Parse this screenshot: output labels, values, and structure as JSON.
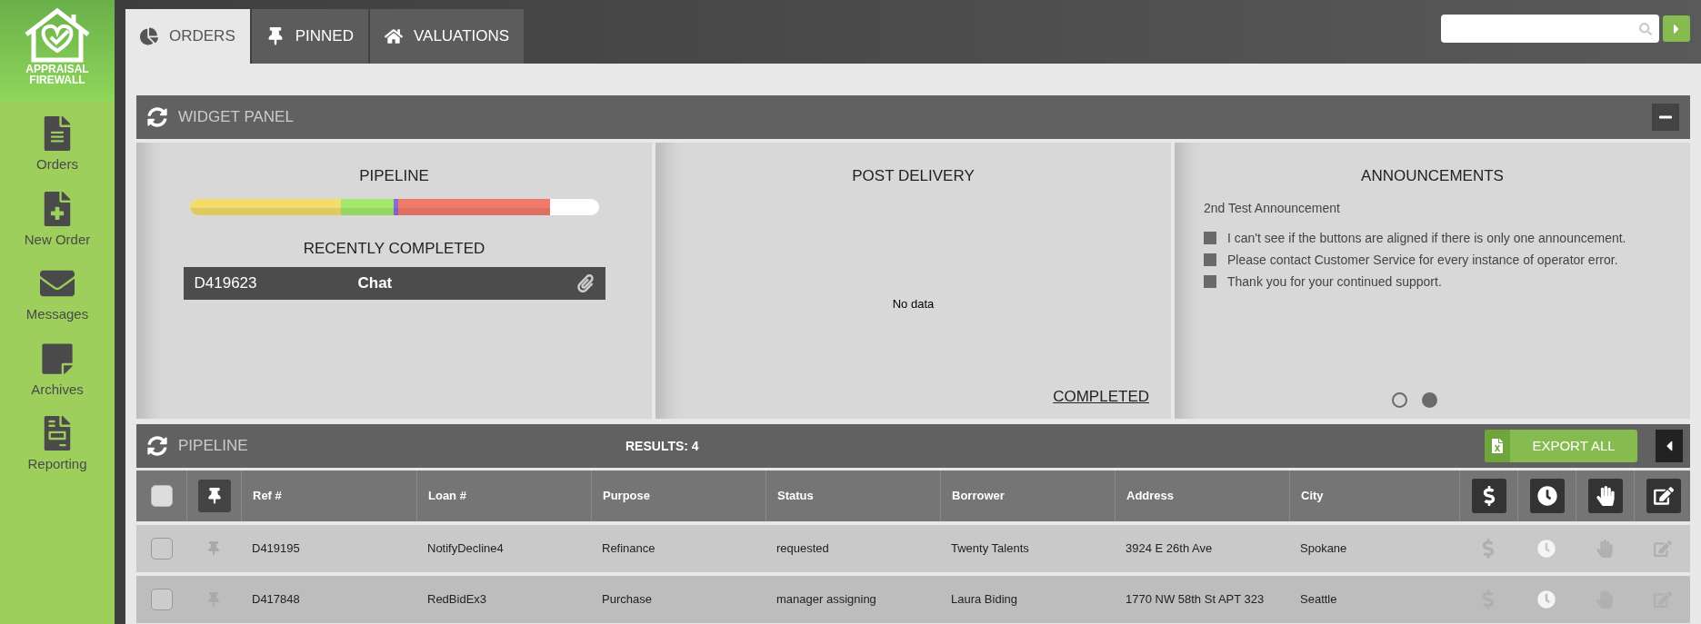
{
  "sidebar": {
    "logo_text": [
      "APPRAISAL",
      "FIREWALL"
    ],
    "items": [
      {
        "kind": "orders",
        "label": "Orders"
      },
      {
        "kind": "new_order",
        "label": "New Order"
      },
      {
        "kind": "messages",
        "label": "Messages"
      },
      {
        "kind": "archives",
        "label": "Archives"
      },
      {
        "kind": "reporting",
        "label": "Reporting"
      }
    ]
  },
  "tabs": [
    {
      "kind": "orders",
      "label": "ORDERS",
      "selected": true
    },
    {
      "kind": "pinned",
      "label": "PINNED",
      "selected": false
    },
    {
      "kind": "valuations",
      "label": "VALUATIONS",
      "selected": false
    }
  ],
  "widget_panel": {
    "title": "WIDGET PANEL",
    "pipeline": {
      "title": "PIPELINE"
    },
    "recently_completed": {
      "title": "RECENTLY COMPLETED",
      "items": [
        {
          "ref": "D419623",
          "type": "Chat"
        }
      ]
    },
    "post_delivery": {
      "title": "POST DELIVERY",
      "message": "No data",
      "link": "COMPLETED"
    },
    "announcements": {
      "title": "ANNOUNCEMENTS",
      "heading": "2nd Test Announcement",
      "items": [
        "I can't see if the buttons are aligned if there is only one announcement.",
        "Please contact Customer Service for every instance of operator error.",
        "Thank you for your continued support."
      ],
      "pages": [
        {
          "selected": false
        },
        {
          "selected": true
        }
      ]
    }
  },
  "pipeline": {
    "title": "PIPELINE",
    "select_all_checked": false,
    "results": "RESULTS: 4",
    "export_button": "EXPORT ALL",
    "columns": [
      "Ref #",
      "Loan #",
      "Purpose",
      "Status",
      "Borrower",
      "Address",
      "City"
    ],
    "rows": [
      {
        "checked": false,
        "cells": [
          "D419195",
          "NotifyDecline4",
          "Refinance",
          "requested",
          "Twenty Talents",
          "3924 E 26th Ave",
          "Spokane"
        ]
      },
      {
        "checked": false,
        "cells": [
          "D417848",
          "RedBidEx3",
          "Purchase",
          "manager assigning",
          "Laura Biding",
          "1770 NW 58th St APT 323",
          "Seattle"
        ]
      }
    ]
  }
}
